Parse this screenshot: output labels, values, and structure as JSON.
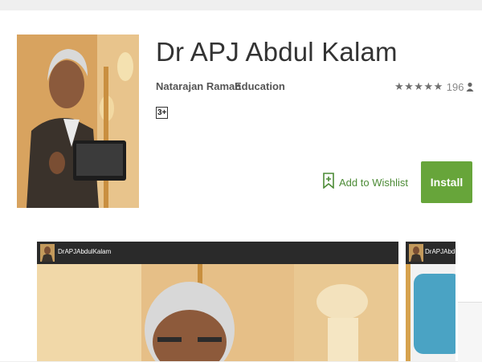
{
  "app": {
    "title": "Dr APJ Abdul Kalam",
    "developer": "Natarajan Raman",
    "category": "Education",
    "rating_stars": "★★★★★",
    "rating_count": "196",
    "content_rating": "3+"
  },
  "actions": {
    "wishlist_label": "Add to Wishlist",
    "install_label": "Install"
  },
  "screenshots": [
    {
      "header_text": "DrAPJAbdulKalam"
    },
    {
      "header_text": "DrAPJAbdulKalam"
    }
  ],
  "colors": {
    "install_bg": "#67a53a",
    "wishlist_text": "#4c8b36",
    "screenshot_header": "#2a2a2a",
    "screenshot_card": "#4aa3c4"
  },
  "icons": [
    "bookmark-plus-icon",
    "person-icon"
  ]
}
